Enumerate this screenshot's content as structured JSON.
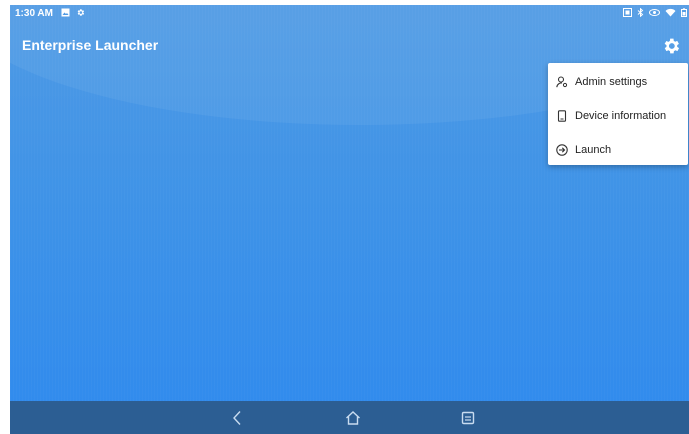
{
  "status_bar": {
    "time": "1:30 AM",
    "left_icons": [
      "image-icon",
      "gear-icon"
    ],
    "right_icons": [
      "nfc-icon",
      "bluetooth-icon",
      "eye-icon",
      "wifi-icon",
      "battery-icon"
    ]
  },
  "app": {
    "title": "Enterprise Launcher",
    "settings_icon": "gear-icon"
  },
  "menu": {
    "items": [
      {
        "label": "Admin settings",
        "icon": "admin-user-icon"
      },
      {
        "label": "Device information",
        "icon": "phone-icon"
      },
      {
        "label": "Launch",
        "icon": "launch-arrow-icon"
      }
    ]
  },
  "nav_bar": {
    "buttons": [
      "back-icon",
      "home-icon",
      "recents-icon"
    ]
  },
  "colors": {
    "background_top": "#4f9ae4",
    "background_bottom": "#2f8aee",
    "nav_bar": "#2c5e93",
    "menu_background": "#ffffff",
    "menu_text": "#222222"
  }
}
